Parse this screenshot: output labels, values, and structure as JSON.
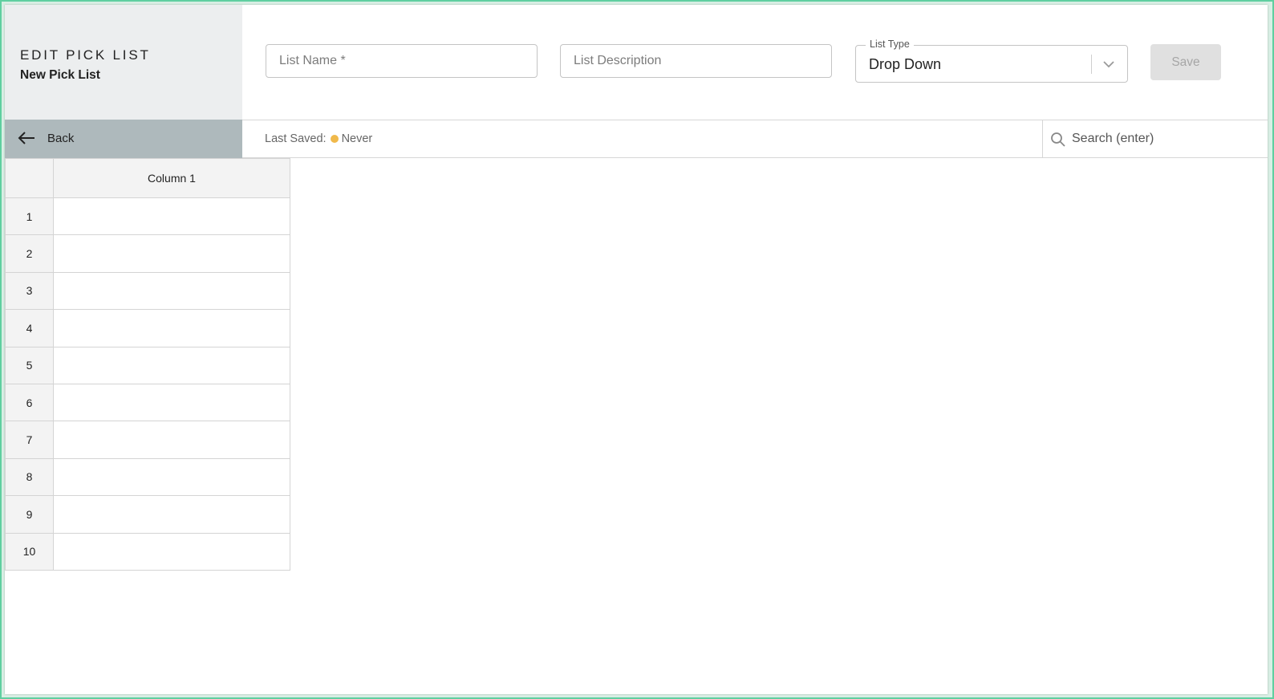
{
  "header": {
    "title": "EDIT PICK LIST",
    "subtitle": "New Pick List",
    "list_name_placeholder": "List Name *",
    "list_description_placeholder": "List Description",
    "list_type_label": "List Type",
    "list_type_value": "Drop Down",
    "save_label": "Save"
  },
  "toolbar": {
    "back_label": "Back",
    "last_saved_label": "Last Saved:",
    "last_saved_value": "Never",
    "search_placeholder": "Search (enter)"
  },
  "grid": {
    "columns": [
      "Column 1"
    ],
    "rows": [
      "1",
      "2",
      "3",
      "4",
      "5",
      "6",
      "7",
      "8",
      "9",
      "10"
    ]
  },
  "colors": {
    "status_dot": "#f0b94b",
    "back_bar": "#aeb9bc",
    "frame_border": "#5fcfa0"
  },
  "icons": [
    "back-arrow-icon",
    "chevron-down-icon",
    "search-icon"
  ]
}
